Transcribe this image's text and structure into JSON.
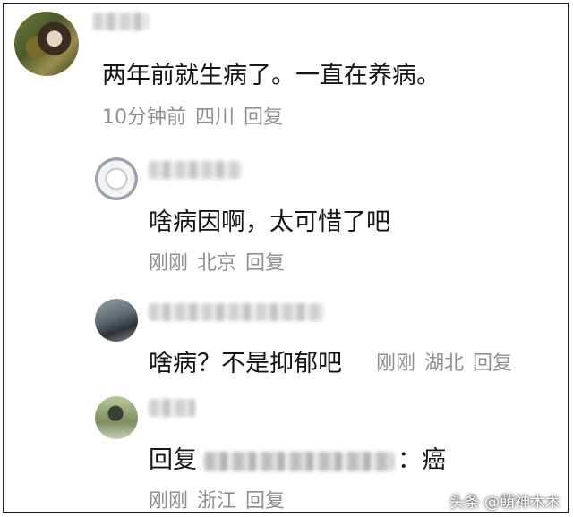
{
  "comments": [
    {
      "text": "两年前就生病了。一直在养病。",
      "time": "10分钟前",
      "location": "四川",
      "reply_label": "回复"
    },
    {
      "text": "啥病因啊，太可惜了吧",
      "time": "刚刚",
      "location": "北京",
      "reply_label": "回复"
    },
    {
      "text": "啥病？不是抑郁吧",
      "time": "刚刚",
      "location": "湖北",
      "reply_label": "回复"
    },
    {
      "text_prefix": "回复",
      "text_suffix": "：癌",
      "time": "刚刚",
      "location": "浙江",
      "reply_label": "回复"
    }
  ],
  "watermark": "头条 @萌神木木"
}
